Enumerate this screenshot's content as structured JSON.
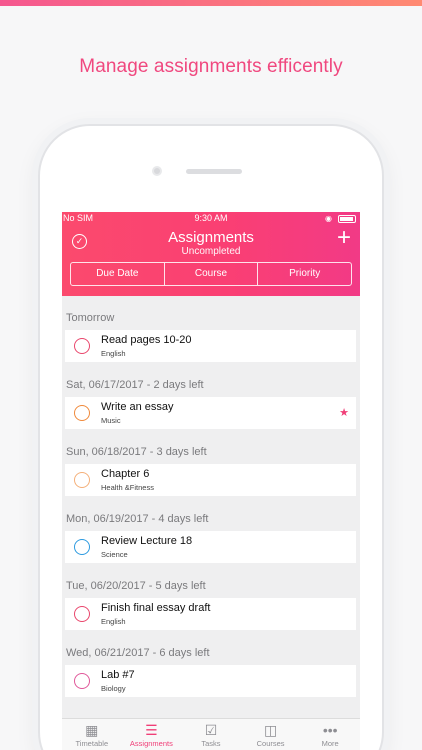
{
  "headline": "Manage assignments efficently",
  "status_bar": {
    "carrier": "No SIM",
    "time": "9:30 AM"
  },
  "header": {
    "title": "Assignments",
    "subtitle": "Uncompleted"
  },
  "segments": [
    "Due Date",
    "Course",
    "Priority"
  ],
  "sections": [
    {
      "label": "Tomorrow",
      "items": [
        {
          "title": "Read pages 10-20",
          "course": "English",
          "color": "#e9476d",
          "starred": false
        }
      ]
    },
    {
      "label": "Sat, 06/17/2017 - 2 days left",
      "items": [
        {
          "title": "Write an essay",
          "course": "Music",
          "color": "#f08a3c",
          "starred": true
        }
      ]
    },
    {
      "label": "Sun, 06/18/2017 - 3 days left",
      "items": [
        {
          "title": "Chapter 6",
          "course": "Health &Fitness",
          "color": "#f4b07a",
          "starred": false
        }
      ]
    },
    {
      "label": "Mon, 06/19/2017 - 4 days left",
      "items": [
        {
          "title": "Review Lecture 18",
          "course": "Science",
          "color": "#2e9be0",
          "starred": false
        }
      ]
    },
    {
      "label": "Tue, 06/20/2017 - 5 days left",
      "items": [
        {
          "title": "Finish final essay draft",
          "course": "English",
          "color": "#e9476d",
          "starred": false
        }
      ]
    },
    {
      "label": "Wed, 06/21/2017 - 6 days left",
      "items": [
        {
          "title": "Lab #7",
          "course": "Biology",
          "color": "#e0589a",
          "starred": false
        }
      ]
    }
  ],
  "tabs": [
    {
      "label": "Timetable",
      "icon": "calendar-icon",
      "active": false
    },
    {
      "label": "Assignments",
      "icon": "list-icon",
      "active": true
    },
    {
      "label": "Tasks",
      "icon": "checkbox-icon",
      "active": false
    },
    {
      "label": "Courses",
      "icon": "book-icon",
      "active": false
    },
    {
      "label": "More",
      "icon": "more-icon",
      "active": false
    }
  ]
}
